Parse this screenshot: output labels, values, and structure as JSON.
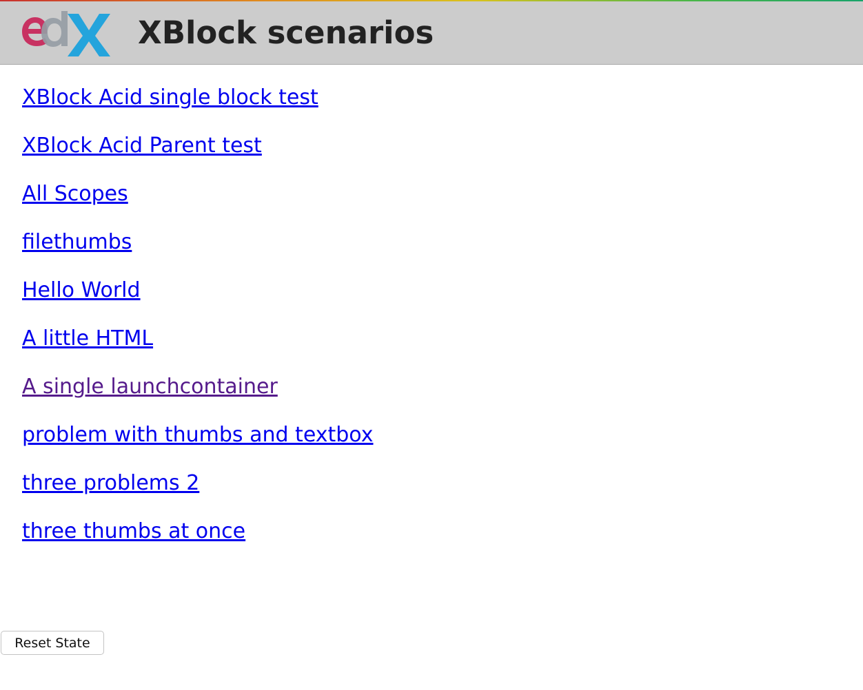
{
  "header": {
    "logo_icon": "edx-logo-icon",
    "title": "XBlock scenarios",
    "colors": {
      "background": "#cccccc",
      "logo_e": "#c82559",
      "logo_d": "#959ca4",
      "logo_x": "#1aa1dc"
    }
  },
  "scenarios": [
    {
      "label": "XBlock Acid single block test",
      "visited": false
    },
    {
      "label": "XBlock Acid Parent test",
      "visited": false
    },
    {
      "label": "All Scopes",
      "visited": false
    },
    {
      "label": "filethumbs",
      "visited": false
    },
    {
      "label": "Hello World",
      "visited": false
    },
    {
      "label": "A little HTML",
      "visited": false
    },
    {
      "label": "A single launchcontainer",
      "visited": true
    },
    {
      "label": "problem with thumbs and textbox",
      "visited": false
    },
    {
      "label": "three problems 2",
      "visited": false
    },
    {
      "label": "three thumbs at once",
      "visited": false
    }
  ],
  "link_colors": {
    "unvisited": "#0000ee",
    "visited": "#551a8b"
  },
  "reset_button": {
    "label": "Reset State"
  }
}
